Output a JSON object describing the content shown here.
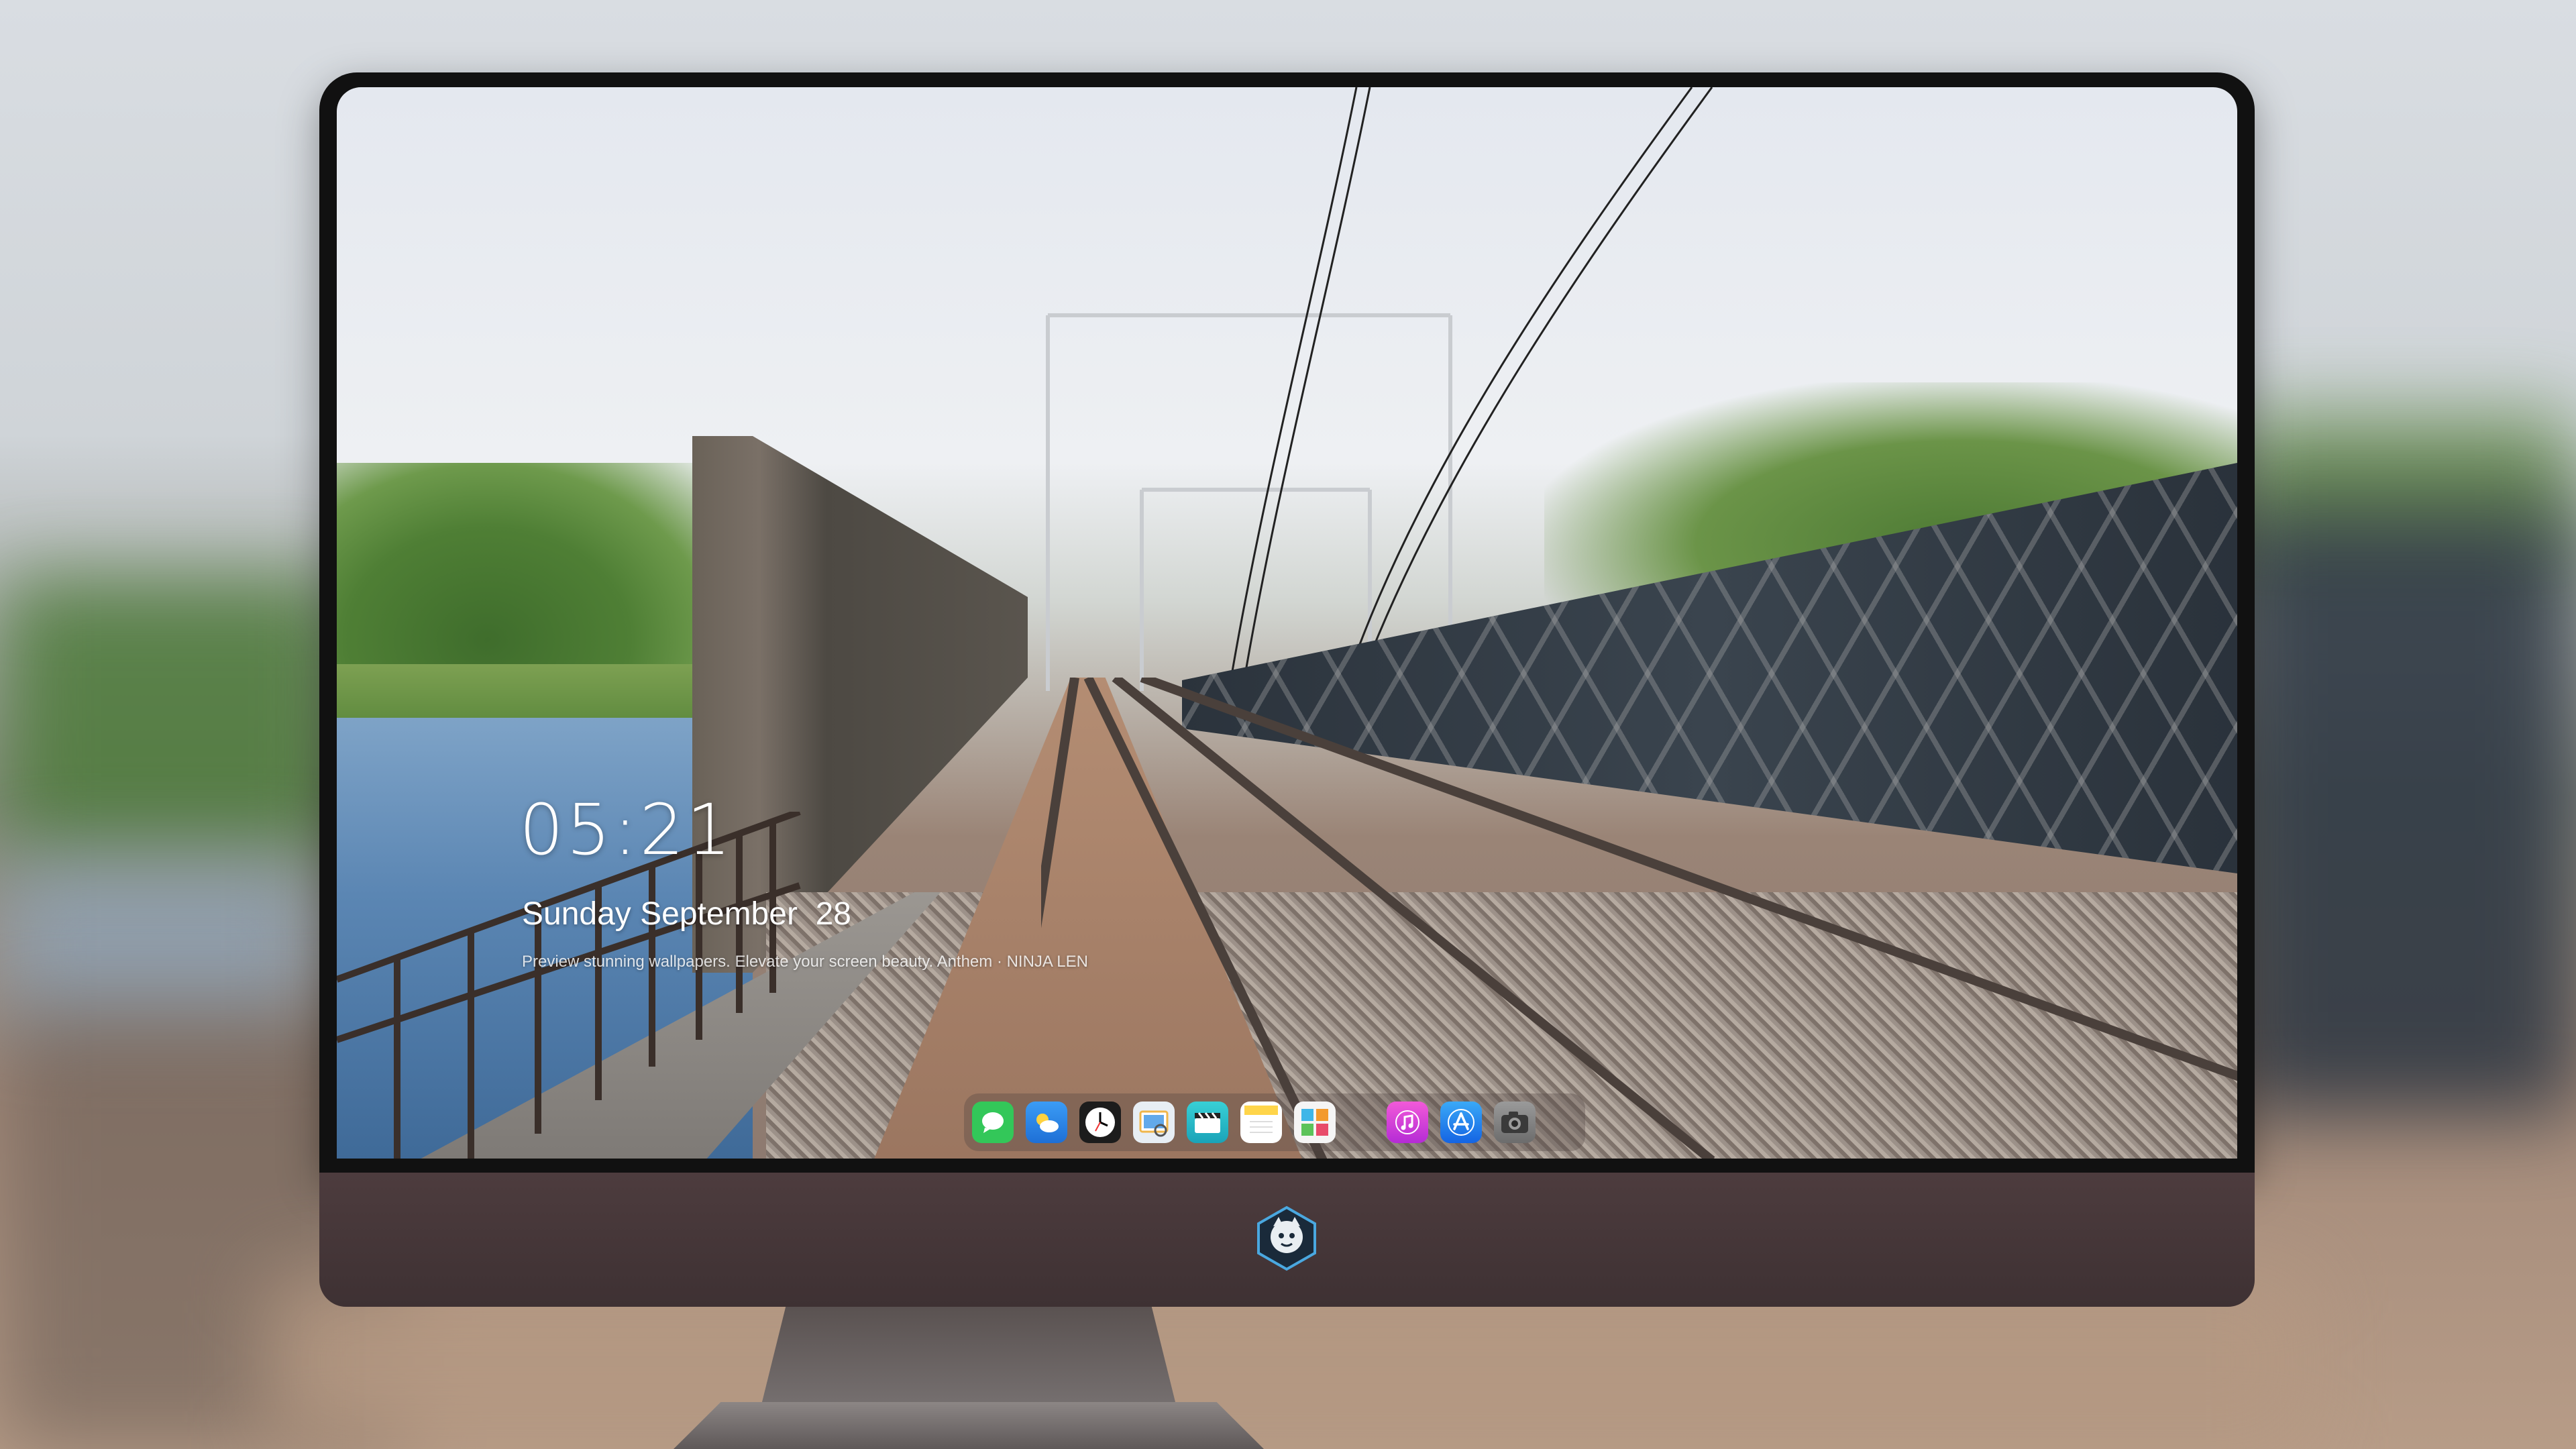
{
  "lock_screen": {
    "time": "05:21",
    "date": "Sunday September  28",
    "caption": "Preview stunning wallpapers. Elevate your screen beauty. Anthem · NINJA LEN"
  },
  "dock": {
    "apps": [
      {
        "name": "Messages",
        "icon": "messages-icon",
        "color": "#33c759"
      },
      {
        "name": "Weather",
        "icon": "weather-icon",
        "color": "#2d8cf0"
      },
      {
        "name": "Clock",
        "icon": "clock-icon",
        "color": "#f2f2f2"
      },
      {
        "name": "Preview",
        "icon": "preview-icon",
        "color": "#3aa0e8"
      },
      {
        "name": "Clips",
        "icon": "clapperboard-icon",
        "color": "#2cc3c9"
      },
      {
        "name": "Notes",
        "icon": "notes-icon",
        "color": "#ffd54a"
      },
      {
        "name": "Photos",
        "icon": "photos-icon",
        "color": "#f0f0f0"
      },
      {
        "name": "Music",
        "icon": "music-icon",
        "color": "#d63bd0"
      },
      {
        "name": "App Store",
        "icon": "app-store-icon",
        "color": "#1e7cf2"
      },
      {
        "name": "Camera",
        "icon": "camera-icon",
        "color": "#8d8d8d"
      }
    ]
  },
  "monitor": {
    "logo_icon": "mascot-logo-icon"
  }
}
